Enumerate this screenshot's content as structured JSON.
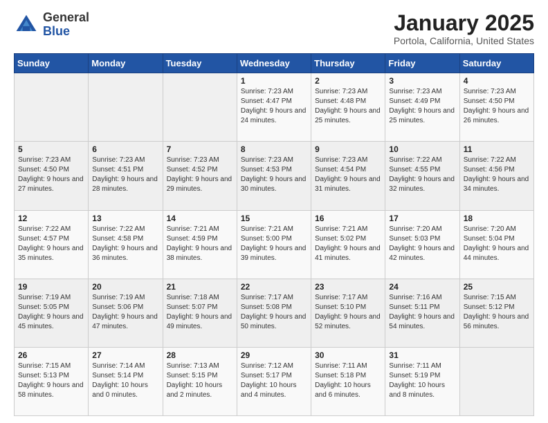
{
  "logo": {
    "general": "General",
    "blue": "Blue"
  },
  "title": "January 2025",
  "subtitle": "Portola, California, United States",
  "days_of_week": [
    "Sunday",
    "Monday",
    "Tuesday",
    "Wednesday",
    "Thursday",
    "Friday",
    "Saturday"
  ],
  "weeks": [
    [
      {
        "day": "",
        "info": ""
      },
      {
        "day": "",
        "info": ""
      },
      {
        "day": "",
        "info": ""
      },
      {
        "day": "1",
        "info": "Sunrise: 7:23 AM\nSunset: 4:47 PM\nDaylight: 9 hours and 24 minutes."
      },
      {
        "day": "2",
        "info": "Sunrise: 7:23 AM\nSunset: 4:48 PM\nDaylight: 9 hours and 25 minutes."
      },
      {
        "day": "3",
        "info": "Sunrise: 7:23 AM\nSunset: 4:49 PM\nDaylight: 9 hours and 25 minutes."
      },
      {
        "day": "4",
        "info": "Sunrise: 7:23 AM\nSunset: 4:50 PM\nDaylight: 9 hours and 26 minutes."
      }
    ],
    [
      {
        "day": "5",
        "info": "Sunrise: 7:23 AM\nSunset: 4:50 PM\nDaylight: 9 hours and 27 minutes."
      },
      {
        "day": "6",
        "info": "Sunrise: 7:23 AM\nSunset: 4:51 PM\nDaylight: 9 hours and 28 minutes."
      },
      {
        "day": "7",
        "info": "Sunrise: 7:23 AM\nSunset: 4:52 PM\nDaylight: 9 hours and 29 minutes."
      },
      {
        "day": "8",
        "info": "Sunrise: 7:23 AM\nSunset: 4:53 PM\nDaylight: 9 hours and 30 minutes."
      },
      {
        "day": "9",
        "info": "Sunrise: 7:23 AM\nSunset: 4:54 PM\nDaylight: 9 hours and 31 minutes."
      },
      {
        "day": "10",
        "info": "Sunrise: 7:22 AM\nSunset: 4:55 PM\nDaylight: 9 hours and 32 minutes."
      },
      {
        "day": "11",
        "info": "Sunrise: 7:22 AM\nSunset: 4:56 PM\nDaylight: 9 hours and 34 minutes."
      }
    ],
    [
      {
        "day": "12",
        "info": "Sunrise: 7:22 AM\nSunset: 4:57 PM\nDaylight: 9 hours and 35 minutes."
      },
      {
        "day": "13",
        "info": "Sunrise: 7:22 AM\nSunset: 4:58 PM\nDaylight: 9 hours and 36 minutes."
      },
      {
        "day": "14",
        "info": "Sunrise: 7:21 AM\nSunset: 4:59 PM\nDaylight: 9 hours and 38 minutes."
      },
      {
        "day": "15",
        "info": "Sunrise: 7:21 AM\nSunset: 5:00 PM\nDaylight: 9 hours and 39 minutes."
      },
      {
        "day": "16",
        "info": "Sunrise: 7:21 AM\nSunset: 5:02 PM\nDaylight: 9 hours and 41 minutes."
      },
      {
        "day": "17",
        "info": "Sunrise: 7:20 AM\nSunset: 5:03 PM\nDaylight: 9 hours and 42 minutes."
      },
      {
        "day": "18",
        "info": "Sunrise: 7:20 AM\nSunset: 5:04 PM\nDaylight: 9 hours and 44 minutes."
      }
    ],
    [
      {
        "day": "19",
        "info": "Sunrise: 7:19 AM\nSunset: 5:05 PM\nDaylight: 9 hours and 45 minutes."
      },
      {
        "day": "20",
        "info": "Sunrise: 7:19 AM\nSunset: 5:06 PM\nDaylight: 9 hours and 47 minutes."
      },
      {
        "day": "21",
        "info": "Sunrise: 7:18 AM\nSunset: 5:07 PM\nDaylight: 9 hours and 49 minutes."
      },
      {
        "day": "22",
        "info": "Sunrise: 7:17 AM\nSunset: 5:08 PM\nDaylight: 9 hours and 50 minutes."
      },
      {
        "day": "23",
        "info": "Sunrise: 7:17 AM\nSunset: 5:10 PM\nDaylight: 9 hours and 52 minutes."
      },
      {
        "day": "24",
        "info": "Sunrise: 7:16 AM\nSunset: 5:11 PM\nDaylight: 9 hours and 54 minutes."
      },
      {
        "day": "25",
        "info": "Sunrise: 7:15 AM\nSunset: 5:12 PM\nDaylight: 9 hours and 56 minutes."
      }
    ],
    [
      {
        "day": "26",
        "info": "Sunrise: 7:15 AM\nSunset: 5:13 PM\nDaylight: 9 hours and 58 minutes."
      },
      {
        "day": "27",
        "info": "Sunrise: 7:14 AM\nSunset: 5:14 PM\nDaylight: 10 hours and 0 minutes."
      },
      {
        "day": "28",
        "info": "Sunrise: 7:13 AM\nSunset: 5:15 PM\nDaylight: 10 hours and 2 minutes."
      },
      {
        "day": "29",
        "info": "Sunrise: 7:12 AM\nSunset: 5:17 PM\nDaylight: 10 hours and 4 minutes."
      },
      {
        "day": "30",
        "info": "Sunrise: 7:11 AM\nSunset: 5:18 PM\nDaylight: 10 hours and 6 minutes."
      },
      {
        "day": "31",
        "info": "Sunrise: 7:11 AM\nSunset: 5:19 PM\nDaylight: 10 hours and 8 minutes."
      },
      {
        "day": "",
        "info": ""
      }
    ]
  ]
}
